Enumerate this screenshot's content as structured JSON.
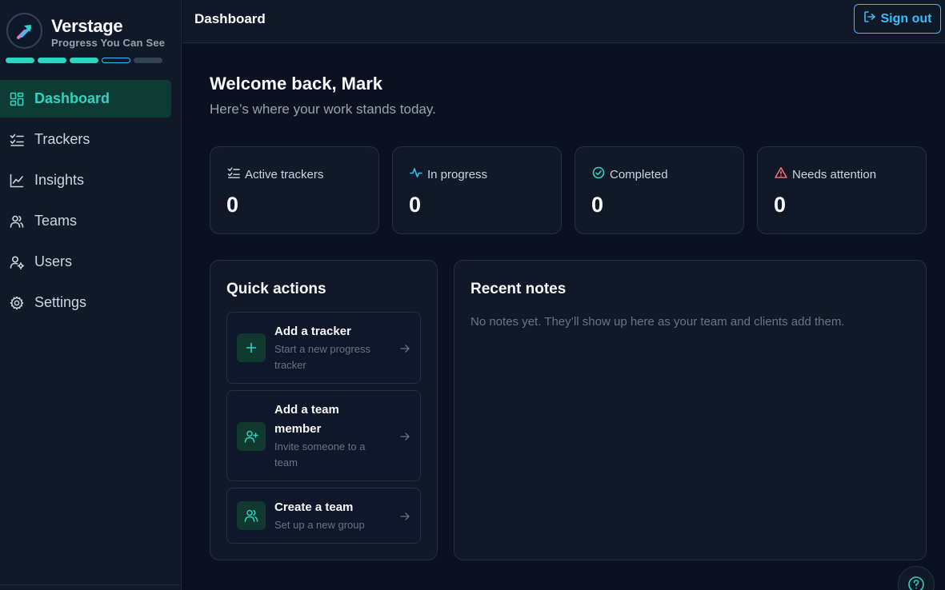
{
  "brand": {
    "name": "Verstage",
    "tagline": "Progress You Can See",
    "progress_segments_filled": 3,
    "progress_segments_current": 1,
    "progress_segments_total": 5
  },
  "sidebar": {
    "items": [
      {
        "label": "Dashboard",
        "icon": "grid-icon",
        "active": true
      },
      {
        "label": "Trackers",
        "icon": "list-check-icon",
        "active": false
      },
      {
        "label": "Insights",
        "icon": "line-chart-icon",
        "active": false
      },
      {
        "label": "Teams",
        "icon": "users-icon",
        "active": false
      },
      {
        "label": "Users",
        "icon": "user-cog-icon",
        "active": false
      },
      {
        "label": "Settings",
        "icon": "gear-icon",
        "active": false
      }
    ]
  },
  "header": {
    "title": "Dashboard",
    "signout_label": "Sign out"
  },
  "main": {
    "welcome": "Welcome back, Mark",
    "subtitle": "Here’s where your work stands today.",
    "stats": [
      {
        "label": "Active trackers",
        "value": "0",
        "icon": "list-check-icon",
        "color": "#cbd5e1"
      },
      {
        "label": "In progress",
        "value": "0",
        "icon": "activity-icon",
        "color": "#38bdf8"
      },
      {
        "label": "Completed",
        "value": "0",
        "icon": "check-circle-icon",
        "color": "#2dd4bf"
      },
      {
        "label": "Needs attention",
        "value": "0",
        "icon": "warning-icon",
        "color": "#f87171"
      }
    ],
    "quick_actions": {
      "title": "Quick actions",
      "items": [
        {
          "title": "Add a tracker",
          "desc": "Start a new progress tracker",
          "icon": "plus-icon"
        },
        {
          "title": "Add a team member",
          "desc": "Invite someone to a team",
          "icon": "user-plus-icon"
        },
        {
          "title": "Create a team",
          "desc": "Set up a new group",
          "icon": "users-icon"
        }
      ]
    },
    "recent_notes": {
      "title": "Recent notes",
      "empty": "No notes yet. They’ll show up here as your team and clients add them."
    }
  },
  "colors": {
    "accent": "#2dd4bf",
    "link": "#38bdf8",
    "background": "#0b1120",
    "surface": "#111827"
  }
}
